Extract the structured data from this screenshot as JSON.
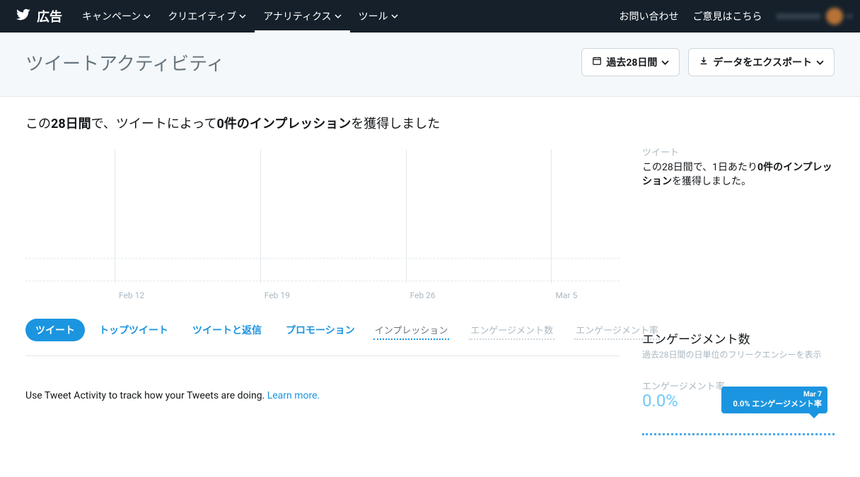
{
  "nav": {
    "brand": "広告",
    "items": [
      {
        "label": "キャンペーン",
        "has_chevron": true,
        "active": false
      },
      {
        "label": "クリエイティブ",
        "has_chevron": true,
        "active": false
      },
      {
        "label": "アナリティクス",
        "has_chevron": true,
        "active": true
      },
      {
        "label": "ツール",
        "has_chevron": true,
        "active": false
      }
    ],
    "right_links": [
      "お問い合わせ",
      "ご意見はこちら"
    ],
    "user_name_blurred": "xxxxxxxxx"
  },
  "subheader": {
    "title": "ツイートアクティビティ",
    "date_button": "過去28日間",
    "export_button": "データをエクスポート"
  },
  "headline": {
    "pre": "この",
    "days": "28日間",
    "mid": "で、ツイートによって",
    "impressions": "0件のインプレッション",
    "post": "を獲得しました"
  },
  "chart_data": {
    "type": "bar",
    "categories": [
      "Feb 12",
      "Feb 19",
      "Feb 26",
      "Mar 5"
    ],
    "values": [
      0,
      0,
      0,
      0
    ],
    "title": "",
    "xlabel": "",
    "ylabel": "",
    "ylim": [
      0,
      1
    ]
  },
  "tabs": {
    "content": [
      {
        "label": "ツイート",
        "active": true
      },
      {
        "label": "トップツイート",
        "active": false
      },
      {
        "label": "ツイートと返信",
        "active": false
      },
      {
        "label": "プロモーション",
        "active": false
      }
    ],
    "metrics": [
      {
        "label": "インプレッション",
        "active": true
      },
      {
        "label": "エンゲージメント数",
        "active": false
      },
      {
        "label": "エンゲージメント率",
        "active": false
      }
    ]
  },
  "footer": {
    "text": "Use Tweet Activity to track how your Tweets are doing. ",
    "link": "Learn more."
  },
  "side": {
    "tweet_label": "ツイート",
    "tweet_text_pre": "この28日間で、1日あたり",
    "tweet_text_bold": "0件のインプレッション",
    "tweet_text_post": "を獲得しました。",
    "eng_title": "エンゲージメント数",
    "eng_sub": "過去28日間の日単位のフリークエンシーを表示",
    "eng_rate_label": "エンゲージメント率",
    "eng_rate_val": "0.0%",
    "tooltip_date": "Mar 7",
    "tooltip_val": "0.0% エンゲージメント率"
  }
}
